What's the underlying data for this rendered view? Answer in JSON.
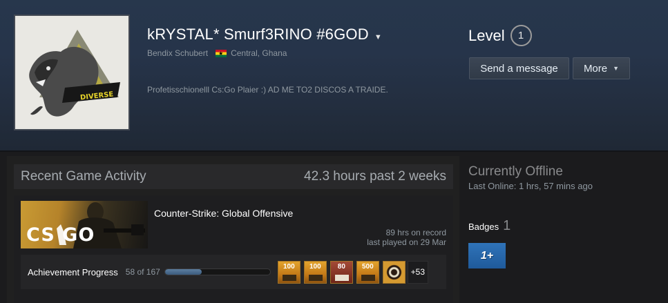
{
  "profile": {
    "persona_name": "kRYSTAL* Smurf3RINO #6GOD",
    "real_name": "Bendix Schubert",
    "location": "Central, Ghana",
    "summary": "Profetisschionelll Cs:Go Plaier :) AD ME TO2 DISCOS A TRAIDE.",
    "avatar_text": "DIVERSE"
  },
  "level": {
    "label": "Level",
    "value": "1"
  },
  "actions": {
    "send_message": "Send a message",
    "more": "More"
  },
  "recent_activity": {
    "title": "Recent Game Activity",
    "hours_summary": "42.3 hours past 2 weeks",
    "game": {
      "name": "Counter-Strike: Global Offensive",
      "capsule_logo": "CS GO",
      "hours_on_record": "89 hrs on record",
      "last_played": "last played on 29 Mar",
      "achievements": {
        "label": "Achievement Progress",
        "count_text": "58 of 167",
        "progress_fraction": 0.347,
        "icons": [
          {
            "name": "pistol-100-icon",
            "text": "100"
          },
          {
            "name": "smg-100-icon",
            "text": "100"
          },
          {
            "name": "shotgun-80-icon",
            "text": "80"
          },
          {
            "name": "rifle-500-icon",
            "text": "500"
          },
          {
            "name": "target-icon",
            "text": ""
          }
        ],
        "more_text": "+53"
      }
    }
  },
  "status": {
    "title": "Currently Offline",
    "last_online": "Last Online: 1 hrs, 57 mins ago"
  },
  "badges": {
    "label": "Badges",
    "count": "1",
    "tile_text": "1+"
  },
  "colors": {
    "header_bg": "#26344a",
    "body_bg": "#1b1b1d",
    "progress_fill": "#4b6d91",
    "badge_blue": "#2a6aac"
  }
}
